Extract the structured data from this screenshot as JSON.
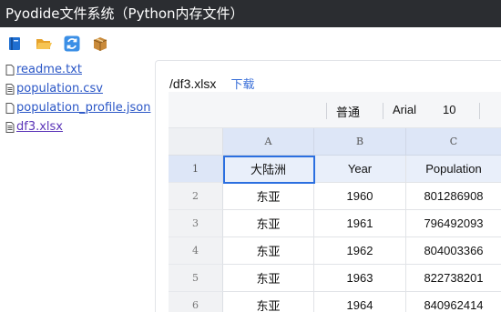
{
  "app": {
    "title": "Pyodide文件系统（Python内存文件）"
  },
  "toolbar": {
    "buttons": [
      {
        "name": "book-button",
        "icon": "book-icon"
      },
      {
        "name": "open-folder-button",
        "icon": "open-folder-icon"
      },
      {
        "name": "refresh-button",
        "icon": "refresh-icon"
      },
      {
        "name": "package-button",
        "icon": "package-icon"
      }
    ]
  },
  "files": [
    {
      "name": "readme.txt",
      "icon": "file-icon"
    },
    {
      "name": "population.csv",
      "icon": "text-file-icon"
    },
    {
      "name": "population_profile.json",
      "icon": "file-icon"
    },
    {
      "name": "df3.xlsx",
      "icon": "text-file-icon",
      "active": true
    }
  ],
  "viewer": {
    "path": "/df3.xlsx",
    "download_label": "下载",
    "format": {
      "style": "普通",
      "font": "Arial",
      "size": "10"
    }
  },
  "sheet": {
    "columns": [
      "A",
      "B",
      "C"
    ],
    "rows": [
      {
        "num": "1",
        "cells": [
          "大陆洲",
          "Year",
          "Population"
        ]
      },
      {
        "num": "2",
        "cells": [
          "东亚",
          "1960",
          "801286908"
        ]
      },
      {
        "num": "3",
        "cells": [
          "东亚",
          "1961",
          "796492093"
        ]
      },
      {
        "num": "4",
        "cells": [
          "东亚",
          "1962",
          "804003366"
        ]
      },
      {
        "num": "5",
        "cells": [
          "东亚",
          "1963",
          "822738201"
        ]
      },
      {
        "num": "6",
        "cells": [
          "东亚",
          "1964",
          "840962414"
        ]
      }
    ]
  },
  "colors": {
    "titlebar": "#2b2d31",
    "link": "#2a56c6",
    "selection": "#2b6fe0",
    "download": "#3a6fd8"
  }
}
